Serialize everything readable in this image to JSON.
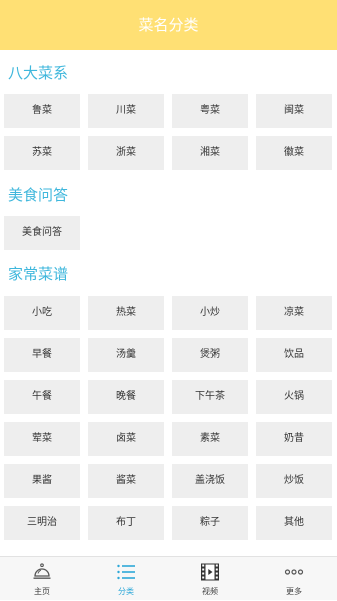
{
  "header": {
    "title": "菜名分类"
  },
  "sections": [
    {
      "title": "八大菜系",
      "items": [
        "鲁菜",
        "川菜",
        "粤菜",
        "闽菜",
        "苏菜",
        "浙菜",
        "湘菜",
        "徽菜"
      ]
    },
    {
      "title": "美食问答",
      "items": [
        "美食问答"
      ]
    },
    {
      "title": "家常菜谱",
      "items": [
        "小吃",
        "热菜",
        "小炒",
        "凉菜",
        "早餐",
        "汤羹",
        "煲粥",
        "饮品",
        "午餐",
        "晚餐",
        "下午茶",
        "火锅",
        "荤菜",
        "卤菜",
        "素菜",
        "奶昔",
        "果酱",
        "酱菜",
        "盖浇饭",
        "炒饭",
        "三明治",
        "布丁",
        "粽子",
        "其他"
      ]
    }
  ],
  "tabbar": {
    "items": [
      {
        "label": "主页",
        "icon": "cloche-icon",
        "active": false
      },
      {
        "label": "分类",
        "icon": "list-icon",
        "active": true
      },
      {
        "label": "视频",
        "icon": "film-play-icon",
        "active": false
      },
      {
        "label": "更多",
        "icon": "more-dots-icon",
        "active": false
      }
    ],
    "active_color": "#2DA8D8"
  },
  "colors": {
    "header_bg": "#FFE074",
    "section_title": "#3FB7DC",
    "cell_bg": "#EEEEEE"
  }
}
